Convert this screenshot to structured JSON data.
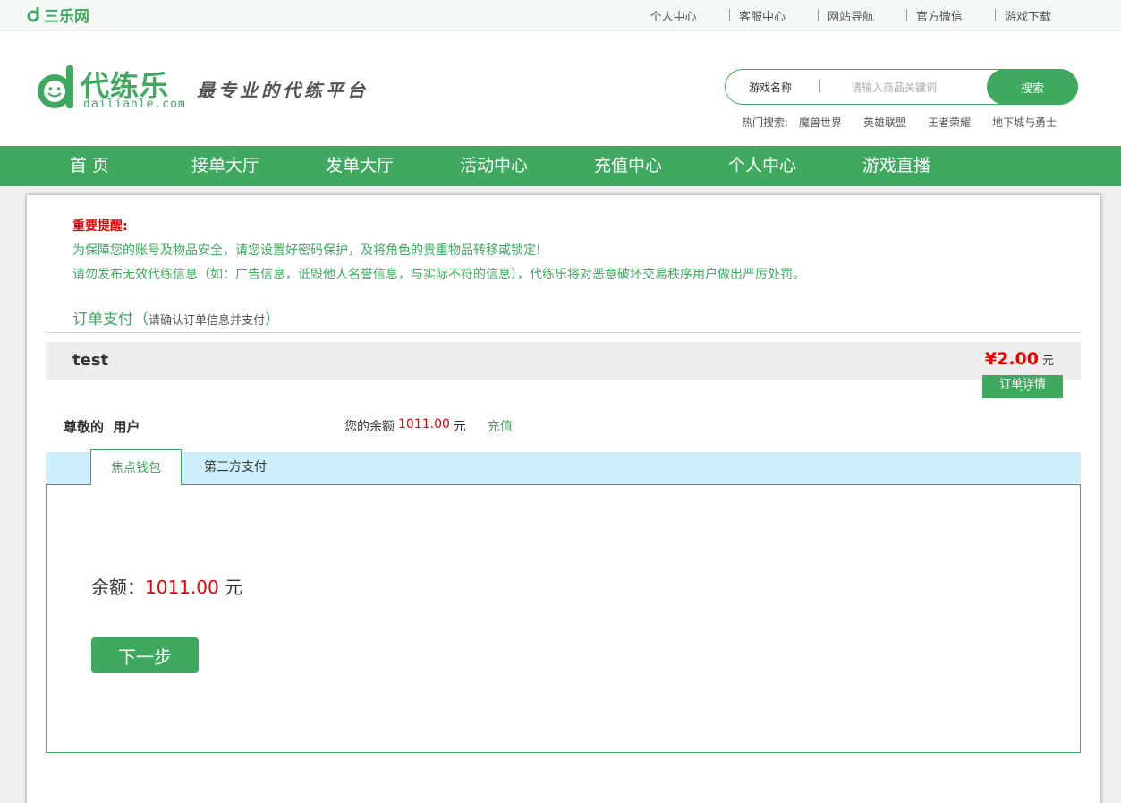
{
  "topbar": {
    "logo_text": "三乐网",
    "links": [
      "个人中心",
      "客服中心",
      "网站导航",
      "官方微信",
      "游戏下载"
    ]
  },
  "header": {
    "brand_name": "代练乐",
    "brand_domain": "dailianle.com",
    "slogan": "最专业的代练平台",
    "search": {
      "category": "游戏名称",
      "placeholder": "请输入商品关键词",
      "button": "搜索"
    },
    "hot": {
      "label": "热门搜索:",
      "items": [
        "魔兽世界",
        "英雄联盟",
        "王者荣耀",
        "地下城与勇士"
      ]
    }
  },
  "nav": [
    "首 页",
    "接单大厅",
    "发单大厅",
    "活动中心",
    "充值中心",
    "个人中心",
    "游戏直播"
  ],
  "notice": {
    "title": "重要提醒:",
    "lines": [
      "为保障您的账号及物品安全，请您设置好密码保护，及将角色的贵重物品转移或锁定!",
      "请勿发布无效代练信息（如：广告信息，诋毁他人名誉信息，与实际不符的信息），代练乐将对恶意破坏交易秩序用户做出严厉处罚。"
    ]
  },
  "section": {
    "title": "订单支付",
    "subtitle": "请确认订单信息并支付"
  },
  "order": {
    "name": "test",
    "price": "¥2.00",
    "unit": "元",
    "detail_button": "订单详情",
    "detail_chevron": "⌄⌄"
  },
  "user": {
    "greeting": "尊敬的  用户",
    "balance_label": "您的余额",
    "balance": "1011.00",
    "balance_unit": "元",
    "recharge": "充值"
  },
  "tabs": [
    "焦点钱包",
    "第三方支付"
  ],
  "wallet": {
    "label": "余额：",
    "amount": "1011.00",
    "unit": "元",
    "next_button": "下一步"
  },
  "colors": {
    "brand": "#3fa960",
    "price": "#ee0000",
    "tab_bar": "#cdeefb"
  }
}
